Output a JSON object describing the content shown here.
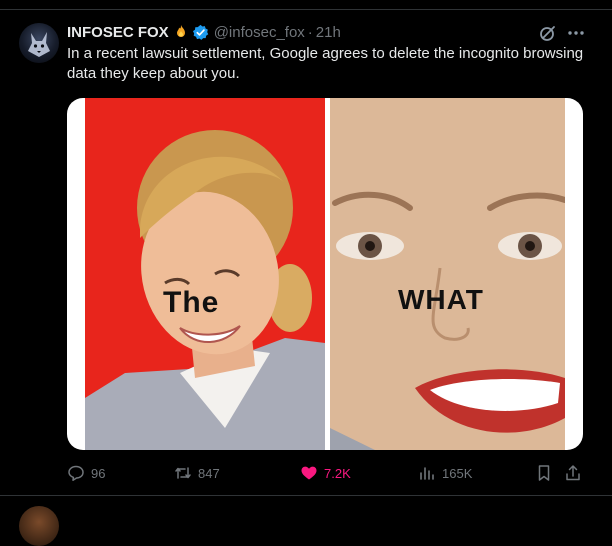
{
  "tweet": {
    "display_name": "INFOSEC FOX",
    "name_emoji_icon": "fire-icon",
    "verified_icon": "verified-badge-icon",
    "handle": "@infosec_fox",
    "separator": "·",
    "time": "21h",
    "text": "In a recent lawsuit settlement, Google agrees to delete the incognito browsing data they keep about you.",
    "media": {
      "left_caption": "The",
      "right_caption": "WHAT"
    },
    "actions": {
      "replies": "96",
      "reposts": "847",
      "likes": "7.2K",
      "views": "165K"
    }
  },
  "colors": {
    "background": "#000000",
    "text": "#e7e9ea",
    "muted": "#71767b",
    "like_active": "#f91880",
    "verified": "#1d9bf0",
    "meme_left_bg": "#e8251c"
  }
}
